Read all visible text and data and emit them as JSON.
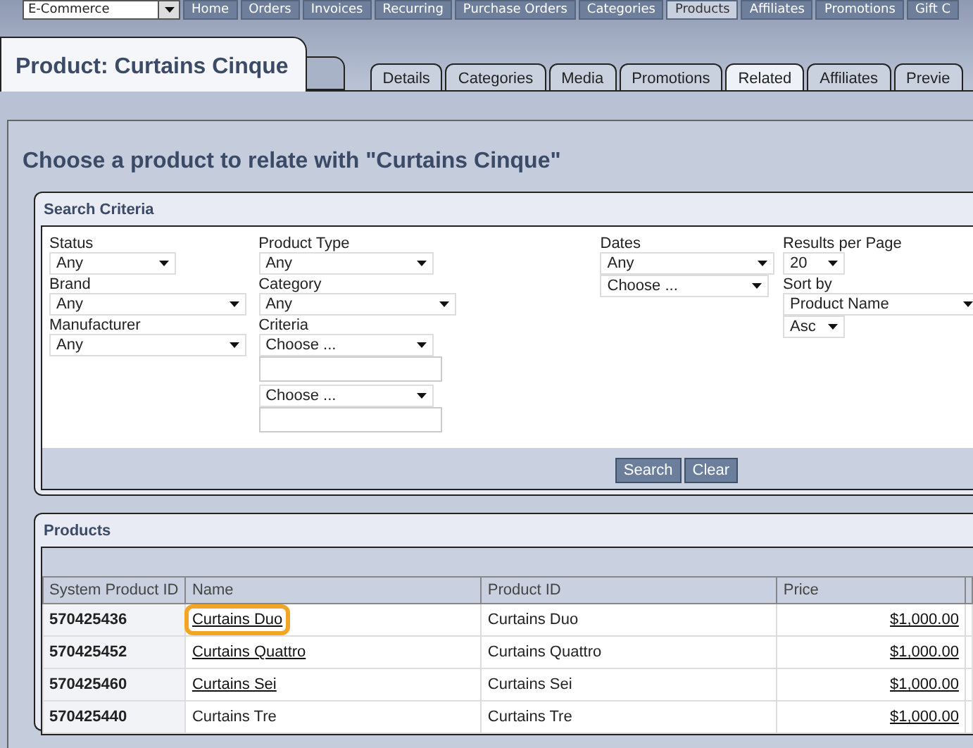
{
  "top_nav": {
    "store_select": {
      "value": "E-Commerce"
    },
    "items": [
      {
        "label": "Home",
        "selected": false
      },
      {
        "label": "Orders",
        "selected": false
      },
      {
        "label": "Invoices",
        "selected": false
      },
      {
        "label": "Recurring",
        "selected": false
      },
      {
        "label": "Purchase Orders",
        "selected": false
      },
      {
        "label": "Categories",
        "selected": false
      },
      {
        "label": "Products",
        "selected": true
      },
      {
        "label": "Affiliates",
        "selected": false
      },
      {
        "label": "Promotions",
        "selected": false
      },
      {
        "label": "Gift C",
        "selected": false
      }
    ]
  },
  "page_title": "Product: Curtains Cinque",
  "tabs": [
    {
      "label": "Details",
      "selected": false
    },
    {
      "label": "Categories",
      "selected": false
    },
    {
      "label": "Media",
      "selected": false
    },
    {
      "label": "Promotions",
      "selected": false
    },
    {
      "label": "Related",
      "selected": true
    },
    {
      "label": "Affiliates",
      "selected": false
    },
    {
      "label": "Previe",
      "selected": false
    }
  ],
  "heading": "Choose a product to relate with \"Curtains Cinque\"",
  "search_criteria": {
    "title": "Search Criteria",
    "columns": [
      [
        {
          "kind": "select",
          "label": "Status",
          "value": "Any"
        },
        {
          "kind": "select",
          "label": "Brand",
          "value": "Any"
        },
        {
          "kind": "select",
          "label": "Manufacturer",
          "value": "Any"
        }
      ],
      [
        {
          "kind": "select",
          "label": "Product Type",
          "value": "Any"
        },
        {
          "kind": "select",
          "label": "Category",
          "value": "Any"
        },
        {
          "kind": "select",
          "label": "Criteria",
          "value": "Choose ..."
        },
        {
          "kind": "text"
        },
        {
          "kind": "select",
          "value": "Choose ..."
        },
        {
          "kind": "text"
        }
      ],
      [
        {
          "kind": "select",
          "label": "Dates",
          "value": "Any"
        },
        {
          "kind": "select",
          "value": "Choose ..."
        }
      ],
      [
        {
          "kind": "select",
          "label": "Results per Page",
          "value": "20"
        },
        {
          "kind": "select",
          "label": "Sort by",
          "value": "Product Name"
        },
        {
          "kind": "select",
          "value": "Asc"
        }
      ]
    ],
    "buttons": [
      "Search",
      "Clear"
    ]
  },
  "products": {
    "title": "Products",
    "columns": [
      "System Product ID",
      "Name",
      "Product ID",
      "Price"
    ],
    "rows": [
      {
        "system_id": "570425436",
        "name": "Curtains Duo",
        "name_link": true,
        "highlighted": true,
        "product_id": "Curtains Duo",
        "price": "$1,000.00"
      },
      {
        "system_id": "570425452",
        "name": "Curtains Quattro",
        "name_link": true,
        "highlighted": false,
        "product_id": "Curtains Quattro",
        "price": "$1,000.00"
      },
      {
        "system_id": "570425460",
        "name": "Curtains Sei",
        "name_link": true,
        "highlighted": false,
        "product_id": "Curtains Sei",
        "price": "$1,000.00"
      },
      {
        "system_id": "570425440",
        "name": "Curtains Tre",
        "name_link": false,
        "highlighted": false,
        "product_id": "Curtains Tre",
        "price": "$1,000.00"
      }
    ]
  }
}
